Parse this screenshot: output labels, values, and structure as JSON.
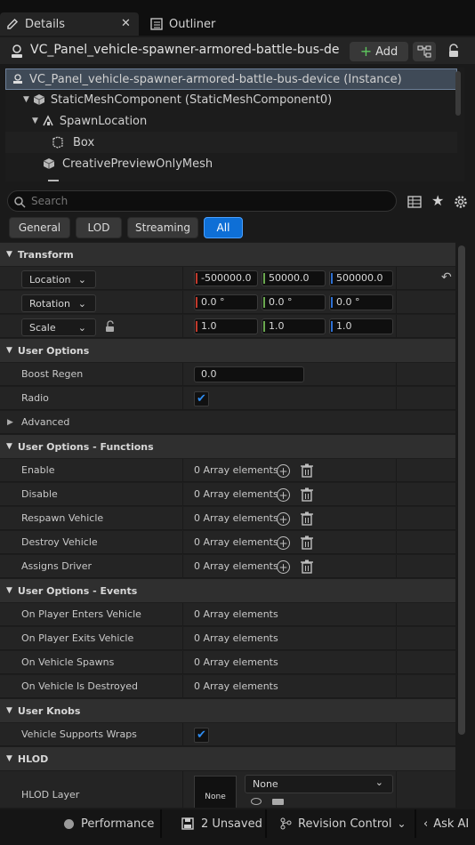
{
  "tabs": [
    {
      "label": "Details",
      "active": true
    },
    {
      "label": "Outliner",
      "active": false
    }
  ],
  "header": {
    "title": "VC_Panel_vehicle-spawner-armored-battle-bus-de",
    "add_label": "Add"
  },
  "tree": [
    {
      "label": "VC_Panel_vehicle-spawner-armored-battle-bus-device (Instance)"
    },
    {
      "label": "StaticMeshComponent (StaticMeshComponent0)"
    },
    {
      "label": "SpawnLocation"
    },
    {
      "label": "Box"
    },
    {
      "label": "CreativePreviewOnlyMesh"
    }
  ],
  "search": {
    "placeholder": "Search"
  },
  "filters": [
    "General",
    "LOD",
    "Streaming",
    "All"
  ],
  "active_filter": "All",
  "transform": {
    "section": "Transform",
    "location": {
      "label": "Location",
      "x": "-500000.0",
      "y": "50000.0",
      "z": "500000.0"
    },
    "rotation": {
      "label": "Rotation",
      "x": "0.0 °",
      "y": "0.0 °",
      "z": "0.0 °"
    },
    "scale": {
      "label": "Scale",
      "x": "1.0",
      "y": "1.0",
      "z": "1.0"
    }
  },
  "user_options": {
    "section": "User Options",
    "boost_regen_label": "Boost Regen",
    "boost_regen_value": "0.0",
    "radio_label": "Radio",
    "radio_checked": true,
    "advanced_label": "Advanced"
  },
  "functions": {
    "section": "User Options - Functions",
    "rows": [
      {
        "label": "Enable",
        "value": "0 Array elements"
      },
      {
        "label": "Disable",
        "value": "0 Array elements"
      },
      {
        "label": "Respawn Vehicle",
        "value": "0 Array elements"
      },
      {
        "label": "Destroy Vehicle",
        "value": "0 Array elements"
      },
      {
        "label": "Assigns Driver",
        "value": "0 Array elements"
      }
    ]
  },
  "events": {
    "section": "User Options - Events",
    "rows": [
      {
        "label": "On Player Enters Vehicle",
        "value": "0 Array elements"
      },
      {
        "label": "On Player Exits Vehicle",
        "value": "0 Array elements"
      },
      {
        "label": "On Vehicle Spawns",
        "value": "0 Array elements"
      },
      {
        "label": "On Vehicle Is Destroyed",
        "value": "0 Array elements"
      }
    ]
  },
  "knobs": {
    "section": "User Knobs",
    "supports_wraps_label": "Vehicle Supports Wraps",
    "supports_wraps_checked": true
  },
  "hlod": {
    "section": "HLOD",
    "layer_label": "HLOD Layer",
    "thumb_label": "None",
    "dropdown_value": "None"
  },
  "statusbar": {
    "performance": "Performance",
    "unsaved": "2 Unsaved",
    "revision": "Revision Control",
    "ask_ai": "Ask AI"
  },
  "colors": {
    "accent": "#0e6fd6",
    "x_axis": "#c0392b",
    "y_axis": "#6aa84f",
    "z_axis": "#2d6fd1",
    "panel": "#242424",
    "section": "#2f2f2f"
  }
}
